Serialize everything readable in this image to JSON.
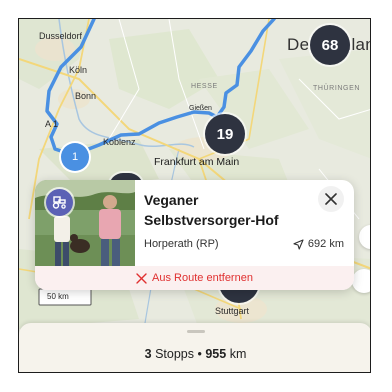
{
  "map": {
    "cities": {
      "dusseldorf": "Dusseldorf",
      "koln": "Köln",
      "bonn": "Bonn",
      "koblenz": "Koblenz",
      "giessen": "Gießen",
      "frankfurt": "Frankfurt am Main",
      "stuttgart": "Stuttgart",
      "a1": "A 1"
    },
    "regions": {
      "hesse": "HESSE",
      "thuringen": "THÜRINGEN"
    },
    "country": "Deutschland",
    "clusters": {
      "top_right": "68",
      "center": "19"
    },
    "stop_pin": "1",
    "scale_label": "50 km"
  },
  "card": {
    "title": "Veganer Selbstversorger-Hof",
    "place": "Horperath (RP)",
    "distance": "692 km",
    "remove_label": "Aus Route entfernen",
    "badge_icon": "tractor-icon"
  },
  "summary": {
    "stops_count": "3",
    "stops_label": "Stopps",
    "separator": "•",
    "km_value": "955",
    "km_unit": "km"
  },
  "colors": {
    "route": "#4a90e2",
    "cluster": "#2e3340",
    "remove": "#e03030",
    "badge": "#5b61b5"
  }
}
